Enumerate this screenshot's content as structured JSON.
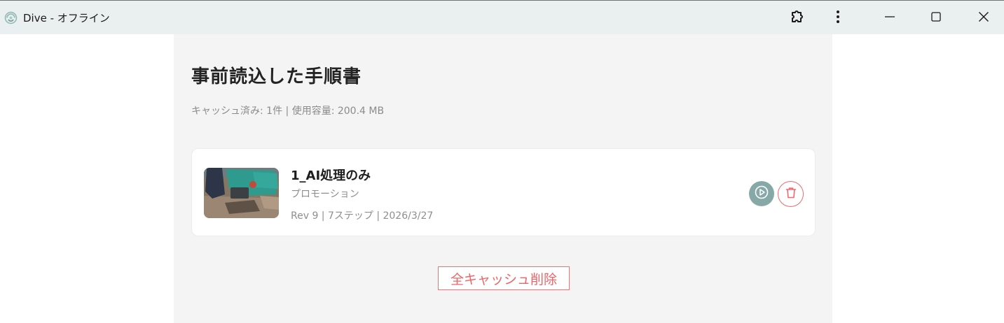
{
  "window": {
    "title": "Dive - オフライン",
    "app_icon": "dive-logo-icon",
    "controls": [
      "extension-icon",
      "more-vert-icon",
      "minimize-icon",
      "maximize-icon",
      "close-icon"
    ]
  },
  "page": {
    "heading": "事前読込した手順書",
    "summary": "キャッシュ済み: 1件 | 使用容量: 200.4 MB"
  },
  "items": [
    {
      "title": "1_AI処理のみ",
      "category": "プロモーション",
      "meta": "Rev 9 | 7ステップ | 2026/3/27",
      "actions": [
        "play-icon",
        "trash-icon"
      ]
    }
  ],
  "footer": {
    "clear_all_label": "全キャッシュ削除"
  },
  "colors": {
    "titlebar_bg": "#eaf0ef",
    "panel_bg": "#f5f4f4",
    "play_button": "#86a9a7",
    "danger": "#f06468"
  }
}
